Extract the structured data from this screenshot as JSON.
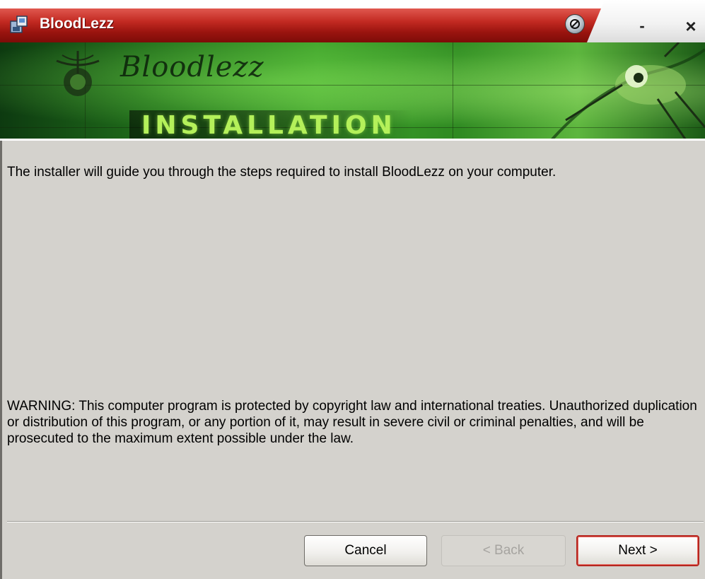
{
  "window": {
    "title": "BloodLezz",
    "controls": {
      "help_icon": "help-icon",
      "minimize_label": "-",
      "close_label": "×"
    }
  },
  "banner": {
    "logo_text": "Bloodlezz",
    "heading": "INSTALLATION"
  },
  "content": {
    "intro": "The installer will guide you through the steps required to install BloodLezz on your computer.",
    "warning": "WARNING: This computer program is protected by copyright law and international treaties. Unauthorized duplication or distribution of this program, or any portion of it, may result in severe civil or criminal penalties, and will be prosecuted to the maximum extent possible under the law."
  },
  "buttons": {
    "cancel": "Cancel",
    "back": "< Back",
    "next": "Next >"
  },
  "colors": {
    "titlebar": "#c32a22",
    "banner_green": "#3fa22b",
    "heading_green": "#b4f05a",
    "background": "#d4d2cd"
  }
}
